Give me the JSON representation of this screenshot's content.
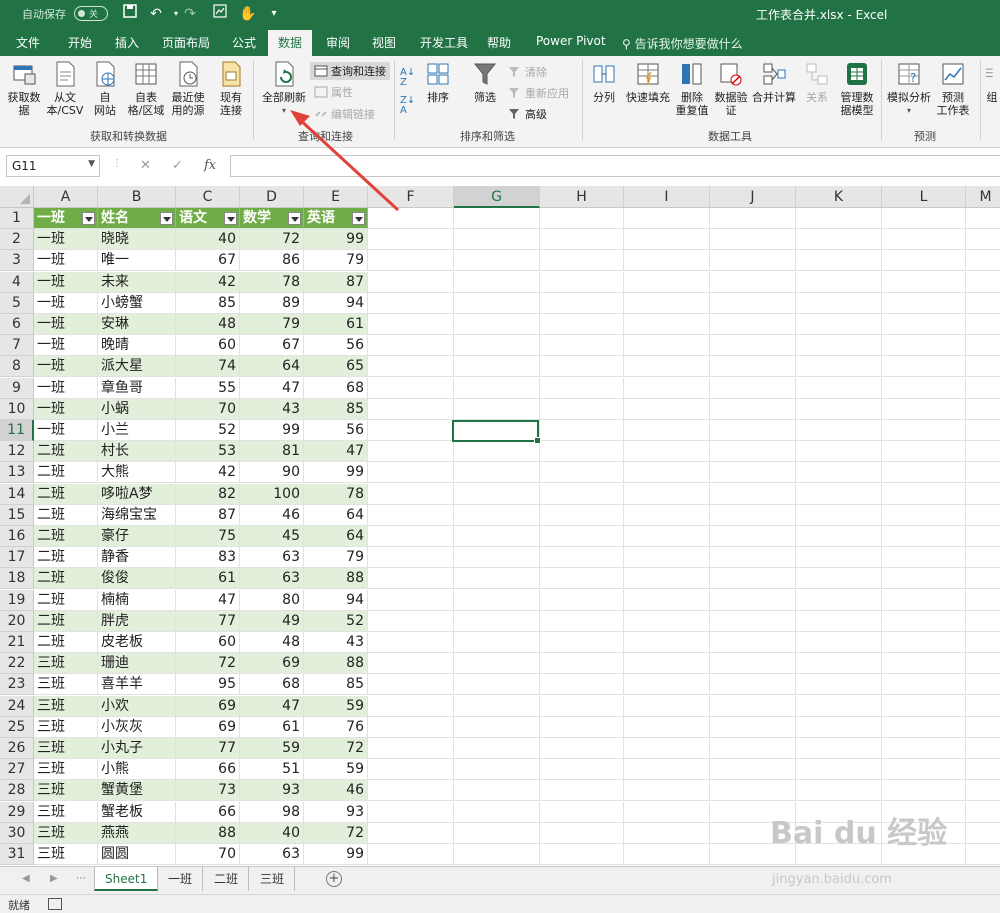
{
  "titlebar": {
    "autosave_label": "自动保存",
    "autosave_state": "关",
    "window_title": "工作表合并.xlsx  -  Excel"
  },
  "tabs": [
    "文件",
    "开始",
    "插入",
    "页面布局",
    "公式",
    "数据",
    "审阅",
    "视图",
    "开发工具",
    "帮助",
    "Power Pivot"
  ],
  "active_tab": "数据",
  "tell_me": "告诉我你想要做什么",
  "ribbon": {
    "get_data": "获取数\n据",
    "from_text": "从文\n本/CSV",
    "from_web": "自\n网站",
    "from_table": "自表\n格/区域",
    "recent_sources": "最近使\n用的源",
    "existing_conn": "现有\n连接",
    "refresh_all": "全部刷新",
    "queries_conn": "查询和连接",
    "properties": "属性",
    "edit_links": "编辑链接",
    "sort": "排序",
    "filter": "筛选",
    "clear": "清除",
    "reapply": "重新应用",
    "advanced": "高级",
    "text_to_cols": "分列",
    "flash_fill": "快速填充",
    "remove_dup": "删除\n重复值",
    "data_valid": "数据验\n证",
    "consolidate": "合并计算",
    "relations": "关系",
    "manage_model": "管理数\n据模型",
    "what_if": "模拟分析",
    "forecast": "预测\n工作表",
    "group_more": "组",
    "group_get": "获取和转换数据",
    "group_query": "查询和连接",
    "group_sort": "排序和筛选",
    "group_tools": "数据工具",
    "group_forecast": "预测"
  },
  "formula_bar": {
    "name_box": "G11",
    "cancel": "✕",
    "enter": "✓",
    "fx": "fx",
    "value": ""
  },
  "columns": [
    "A",
    "B",
    "C",
    "D",
    "E",
    "F",
    "G",
    "H",
    "I",
    "J",
    "K",
    "L",
    "M"
  ],
  "table_headers": [
    "一班",
    "姓名",
    "语文",
    "数学",
    "英语"
  ],
  "rows": [
    [
      "一班",
      "晓晓",
      "40",
      "72",
      "99"
    ],
    [
      "一班",
      "唯一",
      "67",
      "86",
      "79"
    ],
    [
      "一班",
      "未来",
      "42",
      "78",
      "87"
    ],
    [
      "一班",
      "小螃蟹",
      "85",
      "89",
      "94"
    ],
    [
      "一班",
      "安琳",
      "48",
      "79",
      "61"
    ],
    [
      "一班",
      "晚晴",
      "60",
      "67",
      "56"
    ],
    [
      "一班",
      "派大星",
      "74",
      "64",
      "65"
    ],
    [
      "一班",
      "章鱼哥",
      "55",
      "47",
      "68"
    ],
    [
      "一班",
      "小蜗",
      "70",
      "43",
      "85"
    ],
    [
      "一班",
      "小兰",
      "52",
      "99",
      "56"
    ],
    [
      "二班",
      "村长",
      "53",
      "81",
      "47"
    ],
    [
      "二班",
      "大熊",
      "42",
      "90",
      "99"
    ],
    [
      "二班",
      "哆啦A梦",
      "82",
      "100",
      "78"
    ],
    [
      "二班",
      "海绵宝宝",
      "87",
      "46",
      "64"
    ],
    [
      "二班",
      "豪仔",
      "75",
      "45",
      "64"
    ],
    [
      "二班",
      "静香",
      "83",
      "63",
      "79"
    ],
    [
      "二班",
      "俊俊",
      "61",
      "63",
      "88"
    ],
    [
      "二班",
      "楠楠",
      "47",
      "80",
      "94"
    ],
    [
      "二班",
      "胖虎",
      "77",
      "49",
      "52"
    ],
    [
      "二班",
      "皮老板",
      "60",
      "48",
      "43"
    ],
    [
      "三班",
      "珊迪",
      "72",
      "69",
      "88"
    ],
    [
      "三班",
      "喜羊羊",
      "95",
      "68",
      "85"
    ],
    [
      "三班",
      "小欢",
      "69",
      "47",
      "59"
    ],
    [
      "三班",
      "小灰灰",
      "69",
      "61",
      "76"
    ],
    [
      "三班",
      "小丸子",
      "77",
      "59",
      "72"
    ],
    [
      "三班",
      "小熊",
      "66",
      "51",
      "59"
    ],
    [
      "三班",
      "蟹黄堡",
      "73",
      "93",
      "46"
    ],
    [
      "三班",
      "蟹老板",
      "66",
      "98",
      "93"
    ],
    [
      "三班",
      "燕燕",
      "88",
      "40",
      "72"
    ],
    [
      "三班",
      "圆圆",
      "70",
      "63",
      "99"
    ]
  ],
  "sheets": [
    "Sheet1",
    "一班",
    "二班",
    "三班"
  ],
  "active_sheet": "Sheet1",
  "status": "就绪",
  "watermark": "Bai du 经验",
  "watermark_url": "jingyan.baidu.com",
  "colors": {
    "accent": "#217346",
    "table_header": "#70ad47",
    "table_band": "#e2efda",
    "arrow": "#e0423a"
  }
}
